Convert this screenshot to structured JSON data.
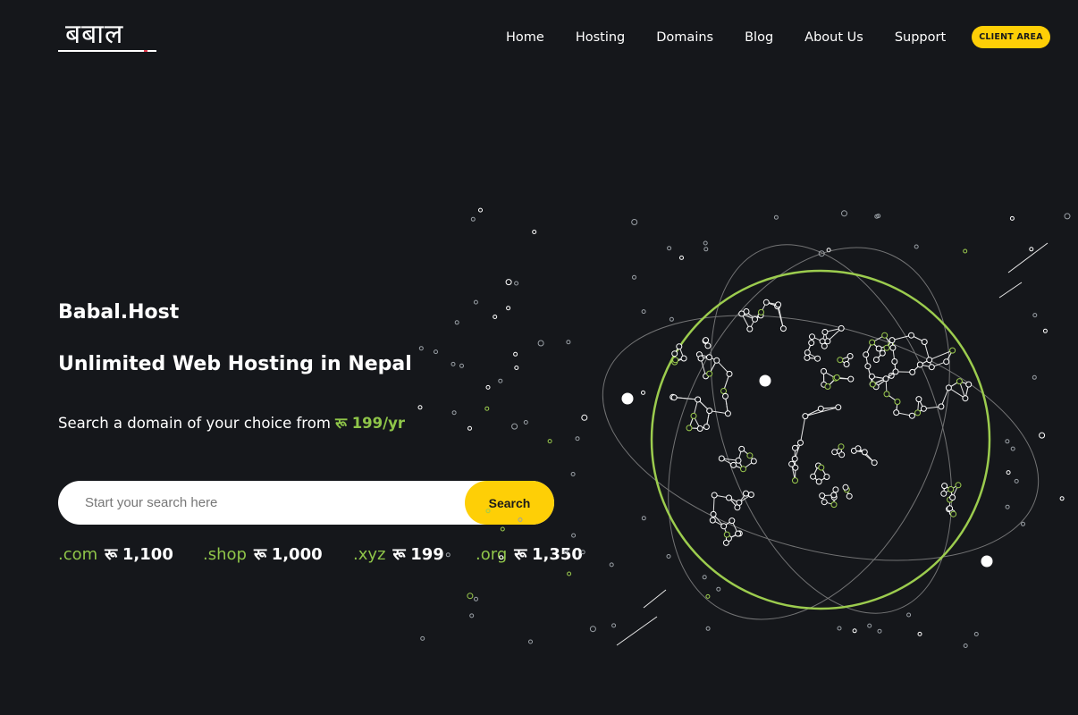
{
  "header": {
    "logo_text": "बबाल",
    "nav": [
      "Home",
      "Hosting",
      "Domains",
      "Blog",
      "About Us",
      "Support"
    ],
    "cta_label": "CLIENT AREA"
  },
  "hero": {
    "brand": "Babal.Host",
    "headline": "Unlimited Web Hosting in Nepal",
    "subline_prefix": "Search a domain of your choice from ",
    "subline_price": "रू 199/yr",
    "search": {
      "placeholder": "Start your search here",
      "button_label": "Search"
    },
    "tlds": [
      {
        "ext": ".com",
        "currency": "रू",
        "price": "1,100"
      },
      {
        "ext": ".shop",
        "currency": "रू",
        "price": "1,000"
      },
      {
        "ext": ".xyz",
        "currency": "रू",
        "price": "199"
      },
      {
        "ext": ".org",
        "currency": "रू",
        "price": "1,350"
      }
    ]
  },
  "colors": {
    "background": "#15171b",
    "accent_yellow": "#fecf06",
    "accent_green": "#8fc549"
  }
}
